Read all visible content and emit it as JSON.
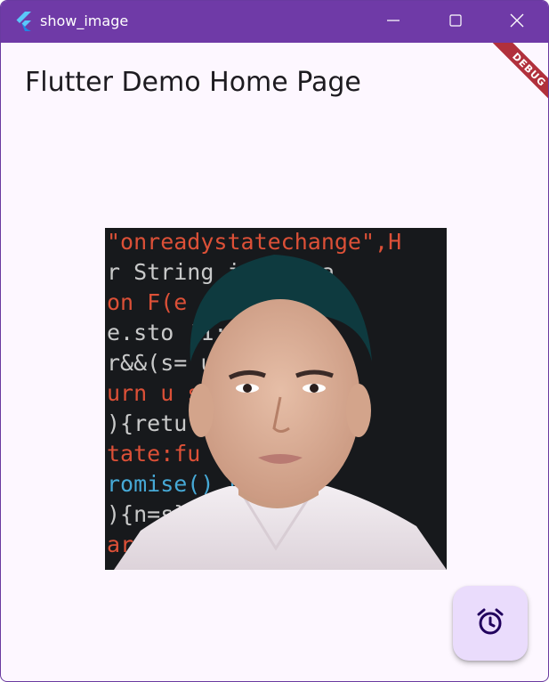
{
  "window": {
    "title": "show_image",
    "app_icon": "flutter-logo-icon",
    "controls": {
      "minimize_icon": "minimize-icon",
      "maximize_icon": "maximize-icon",
      "close_icon": "close-icon"
    },
    "titlebar_color": "#6f3aa7"
  },
  "appbar": {
    "title": "Flutter Demo Home Page"
  },
  "debug_banner": {
    "label": "DEBUG",
    "color": "#b1303c"
  },
  "body": {
    "image": {
      "description_icon": "portrait-photo",
      "code_lines": [
        "\"onreadystatechange\",H",
        "r String    ion Arra",
        "on F(e     e]={};",
        "e.sto         !1;br",
        "r&&(s=        urn t",
        "urn u         sable",
        "){retu         ith(th",
        "tate:fu      {return",
        "romise()      resolve",
        "){n=s}        ].disab",
        "arg           ith,"
      ]
    }
  },
  "fab": {
    "icon": "alarm-clock-icon",
    "background": "#eadcfc"
  }
}
